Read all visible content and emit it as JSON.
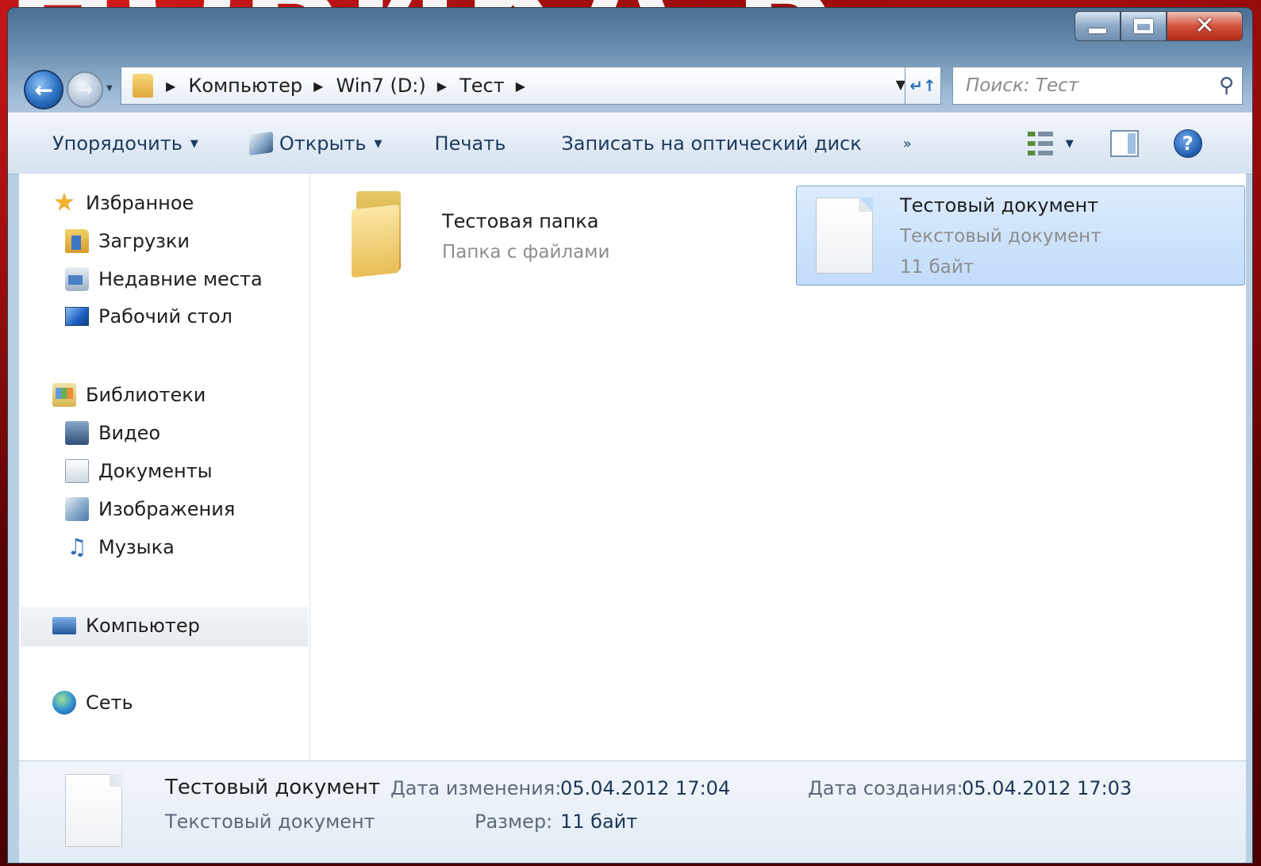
{
  "background": {
    "title_fragment": "НОВИКА В"
  },
  "window": {
    "caption_buttons": {
      "minimize": "minimize",
      "maximize": "maximize",
      "close": "✕"
    }
  },
  "address_bar": {
    "breadcrumbs": [
      "Компьютер",
      "Win7 (D:)",
      "Тест"
    ]
  },
  "search": {
    "placeholder": "Поиск: Тест"
  },
  "toolbar": {
    "organize": "Упорядочить",
    "open": "Открыть",
    "print": "Печать",
    "burn": "Записать на оптический диск",
    "more": "»"
  },
  "nav_pane": {
    "favorites": "Избранное",
    "downloads": "Загрузки",
    "recent": "Недавние места",
    "desktop": "Рабочий стол",
    "libraries": "Библиотеки",
    "video": "Видео",
    "documents": "Документы",
    "images": "Изображения",
    "music": "Музыка",
    "computer": "Компьютер",
    "network": "Сеть"
  },
  "files": [
    {
      "name": "Тестовая папка",
      "type": "Папка с файлами"
    },
    {
      "name": "Тестовый документ",
      "type": "Текстовый документ",
      "size": "11 байт",
      "selected": true
    }
  ],
  "details": {
    "name": "Тестовый документ",
    "type": "Текстовый документ",
    "modified_label": "Дата изменения:",
    "modified_value": "05.04.2012 17:04",
    "created_label": "Дата создания:",
    "created_value": "05.04.2012 17:03",
    "size_label": "Размер:",
    "size_value": "11 байт"
  },
  "colors": {
    "selection": "#c1dcfa",
    "accent": "#2a6fc2",
    "background_red": "#b00f0f"
  }
}
